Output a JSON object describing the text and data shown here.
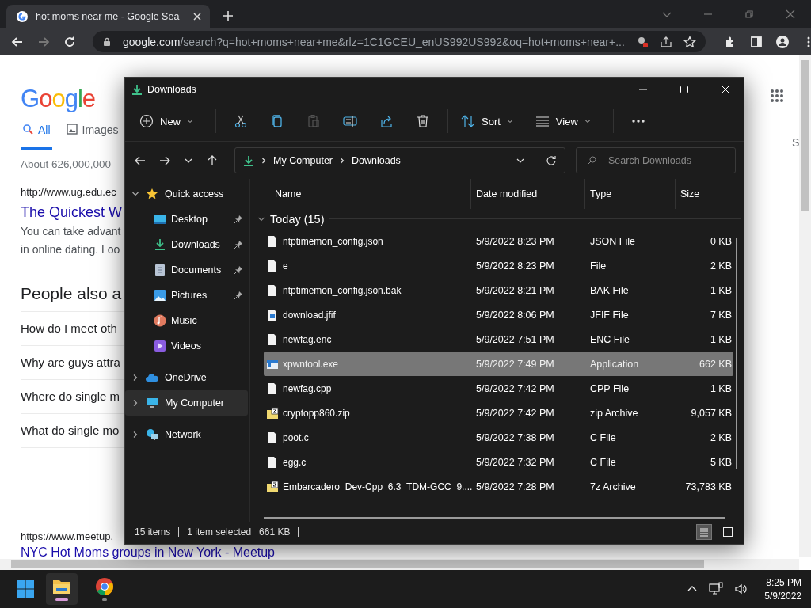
{
  "browser": {
    "tab_title": "hot moms near me - Google Sea",
    "url_domain": "google.com",
    "url_path": "/search?q=hot+moms+near+me&rlz=1C1GCEU_enUS992US992&oq=hot+moms+near+..."
  },
  "google": {
    "logo": "Google",
    "tabs": [
      {
        "label": "All",
        "selected": true
      },
      {
        "label": "Images",
        "selected": false
      }
    ],
    "right_tab": "S",
    "result_count": "About 626,000,000",
    "result_url": "http://www.ug.edu.ec",
    "result_title": "The Quickest W",
    "result_snippet": [
      "You can take advant",
      "in online dating. Loo"
    ],
    "paa_heading": "People also a",
    "questions": [
      "How do I meet oth",
      "Why are guys attra",
      "Where do single m",
      "What do single mo"
    ],
    "second_url": "https://www.meetup.",
    "second_title": "NYC Hot Moms groups in New York - Meetup"
  },
  "explorer": {
    "title": "Downloads",
    "toolbar": {
      "new_label": "New",
      "sort_label": "Sort",
      "view_label": "View",
      "paste_disabled": true
    },
    "breadcrumbs": [
      "My Computer",
      "Downloads"
    ],
    "search": {
      "placeholder": "Search Downloads"
    },
    "nav": [
      {
        "label": "Quick access",
        "kind": "star",
        "expanded": true,
        "selected": false,
        "children": [
          {
            "label": "Desktop",
            "kind": "desktop",
            "pinned": true,
            "selected": false
          },
          {
            "label": "Downloads",
            "kind": "download",
            "pinned": true,
            "selected": false
          },
          {
            "label": "Documents",
            "kind": "document",
            "pinned": true,
            "selected": false
          },
          {
            "label": "Pictures",
            "kind": "picture",
            "pinned": true,
            "selected": false
          },
          {
            "label": "Music",
            "kind": "music",
            "pinned": false,
            "selected": false
          },
          {
            "label": "Videos",
            "kind": "video",
            "pinned": false,
            "selected": false
          }
        ]
      },
      {
        "label": "OneDrive",
        "kind": "cloud",
        "expanded": false,
        "selected": false
      },
      {
        "label": "My Computer",
        "kind": "computer",
        "expanded": false,
        "selected": true
      },
      {
        "label": "Network",
        "kind": "network",
        "expanded": false,
        "selected": false
      }
    ],
    "columns": [
      "Name",
      "Date modified",
      "Type",
      "Size"
    ],
    "group": {
      "label": "Today (15)",
      "expanded": true
    },
    "files": [
      {
        "name": "ntptimemon_config.json",
        "date": "5/9/2022 8:23 PM",
        "type": "JSON File",
        "size": "0 KB",
        "kind": "file",
        "selected": false
      },
      {
        "name": "e",
        "date": "5/9/2022 8:23 PM",
        "type": "File",
        "size": "2 KB",
        "kind": "file",
        "selected": false
      },
      {
        "name": "ntptimemon_config.json.bak",
        "date": "5/9/2022 8:21 PM",
        "type": "BAK File",
        "size": "1 KB",
        "kind": "file",
        "selected": false
      },
      {
        "name": "download.jfif",
        "date": "5/9/2022 8:06 PM",
        "type": "JFIF File",
        "size": "7 KB",
        "kind": "image",
        "selected": false
      },
      {
        "name": "newfag.enc",
        "date": "5/9/2022 7:51 PM",
        "type": "ENC File",
        "size": "1 KB",
        "kind": "file",
        "selected": false
      },
      {
        "name": "xpwntool.exe",
        "date": "5/9/2022 7:49 PM",
        "type": "Application",
        "size": "662 KB",
        "kind": "app",
        "selected": true
      },
      {
        "name": "newfag.cpp",
        "date": "5/9/2022 7:42 PM",
        "type": "CPP File",
        "size": "1 KB",
        "kind": "file",
        "selected": false
      },
      {
        "name": "cryptopp860.zip",
        "date": "5/9/2022 7:42 PM",
        "type": "zip Archive",
        "size": "9,057 KB",
        "kind": "archive",
        "selected": false
      },
      {
        "name": "poot.c",
        "date": "5/9/2022 7:38 PM",
        "type": "C File",
        "size": "2 KB",
        "kind": "file",
        "selected": false
      },
      {
        "name": "egg.c",
        "date": "5/9/2022 7:32 PM",
        "type": "C File",
        "size": "5 KB",
        "kind": "file",
        "selected": false
      },
      {
        "name": "Embarcadero_Dev-Cpp_6.3_TDM-GCC_9....",
        "date": "5/9/2022 7:28 PM",
        "type": "7z Archive",
        "size": "73,783 KB",
        "kind": "archive",
        "selected": false
      }
    ],
    "status": {
      "count": "15 items",
      "selection": "1 item selected",
      "size": "661 KB"
    },
    "views": [
      {
        "kind": "details",
        "selected": true
      },
      {
        "kind": "tiles",
        "selected": false
      }
    ]
  },
  "taskbar": {
    "apps": [
      {
        "kind": "folder",
        "active": true
      },
      {
        "kind": "browser",
        "active": false
      }
    ],
    "time": "8:25 PM",
    "date": "5/9/2022"
  }
}
